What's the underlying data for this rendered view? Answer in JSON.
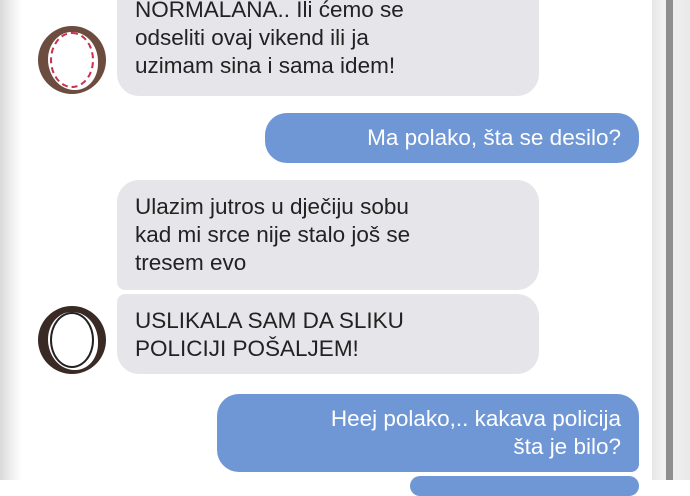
{
  "messages": [
    {
      "direction": "incoming",
      "text": "NORMALANA.. Ili ćemo se\nodseliti ovaj vikend ili ja\nuzimam sina i sama idem!"
    },
    {
      "direction": "outgoing",
      "text": "Ma polako, šta se desilo?"
    },
    {
      "direction": "incoming",
      "text": "Ulazim jutros u dječiju sobu\nkad mi srce nije stalo još se\ntresem evo"
    },
    {
      "direction": "incoming",
      "text": "USLIKALA SAM DA SLIKU\nPOLICIJI POŠALJEM!"
    },
    {
      "direction": "outgoing",
      "text": "Heej polako,.. kakava policija\nšta je bilo?"
    }
  ],
  "colors": {
    "incoming_bubble": "#e6e6ea",
    "outgoing_bubble": "#6f97d6",
    "outgoing_text": "#ffffff"
  },
  "icons": {
    "avatar": "avatar-icon"
  }
}
